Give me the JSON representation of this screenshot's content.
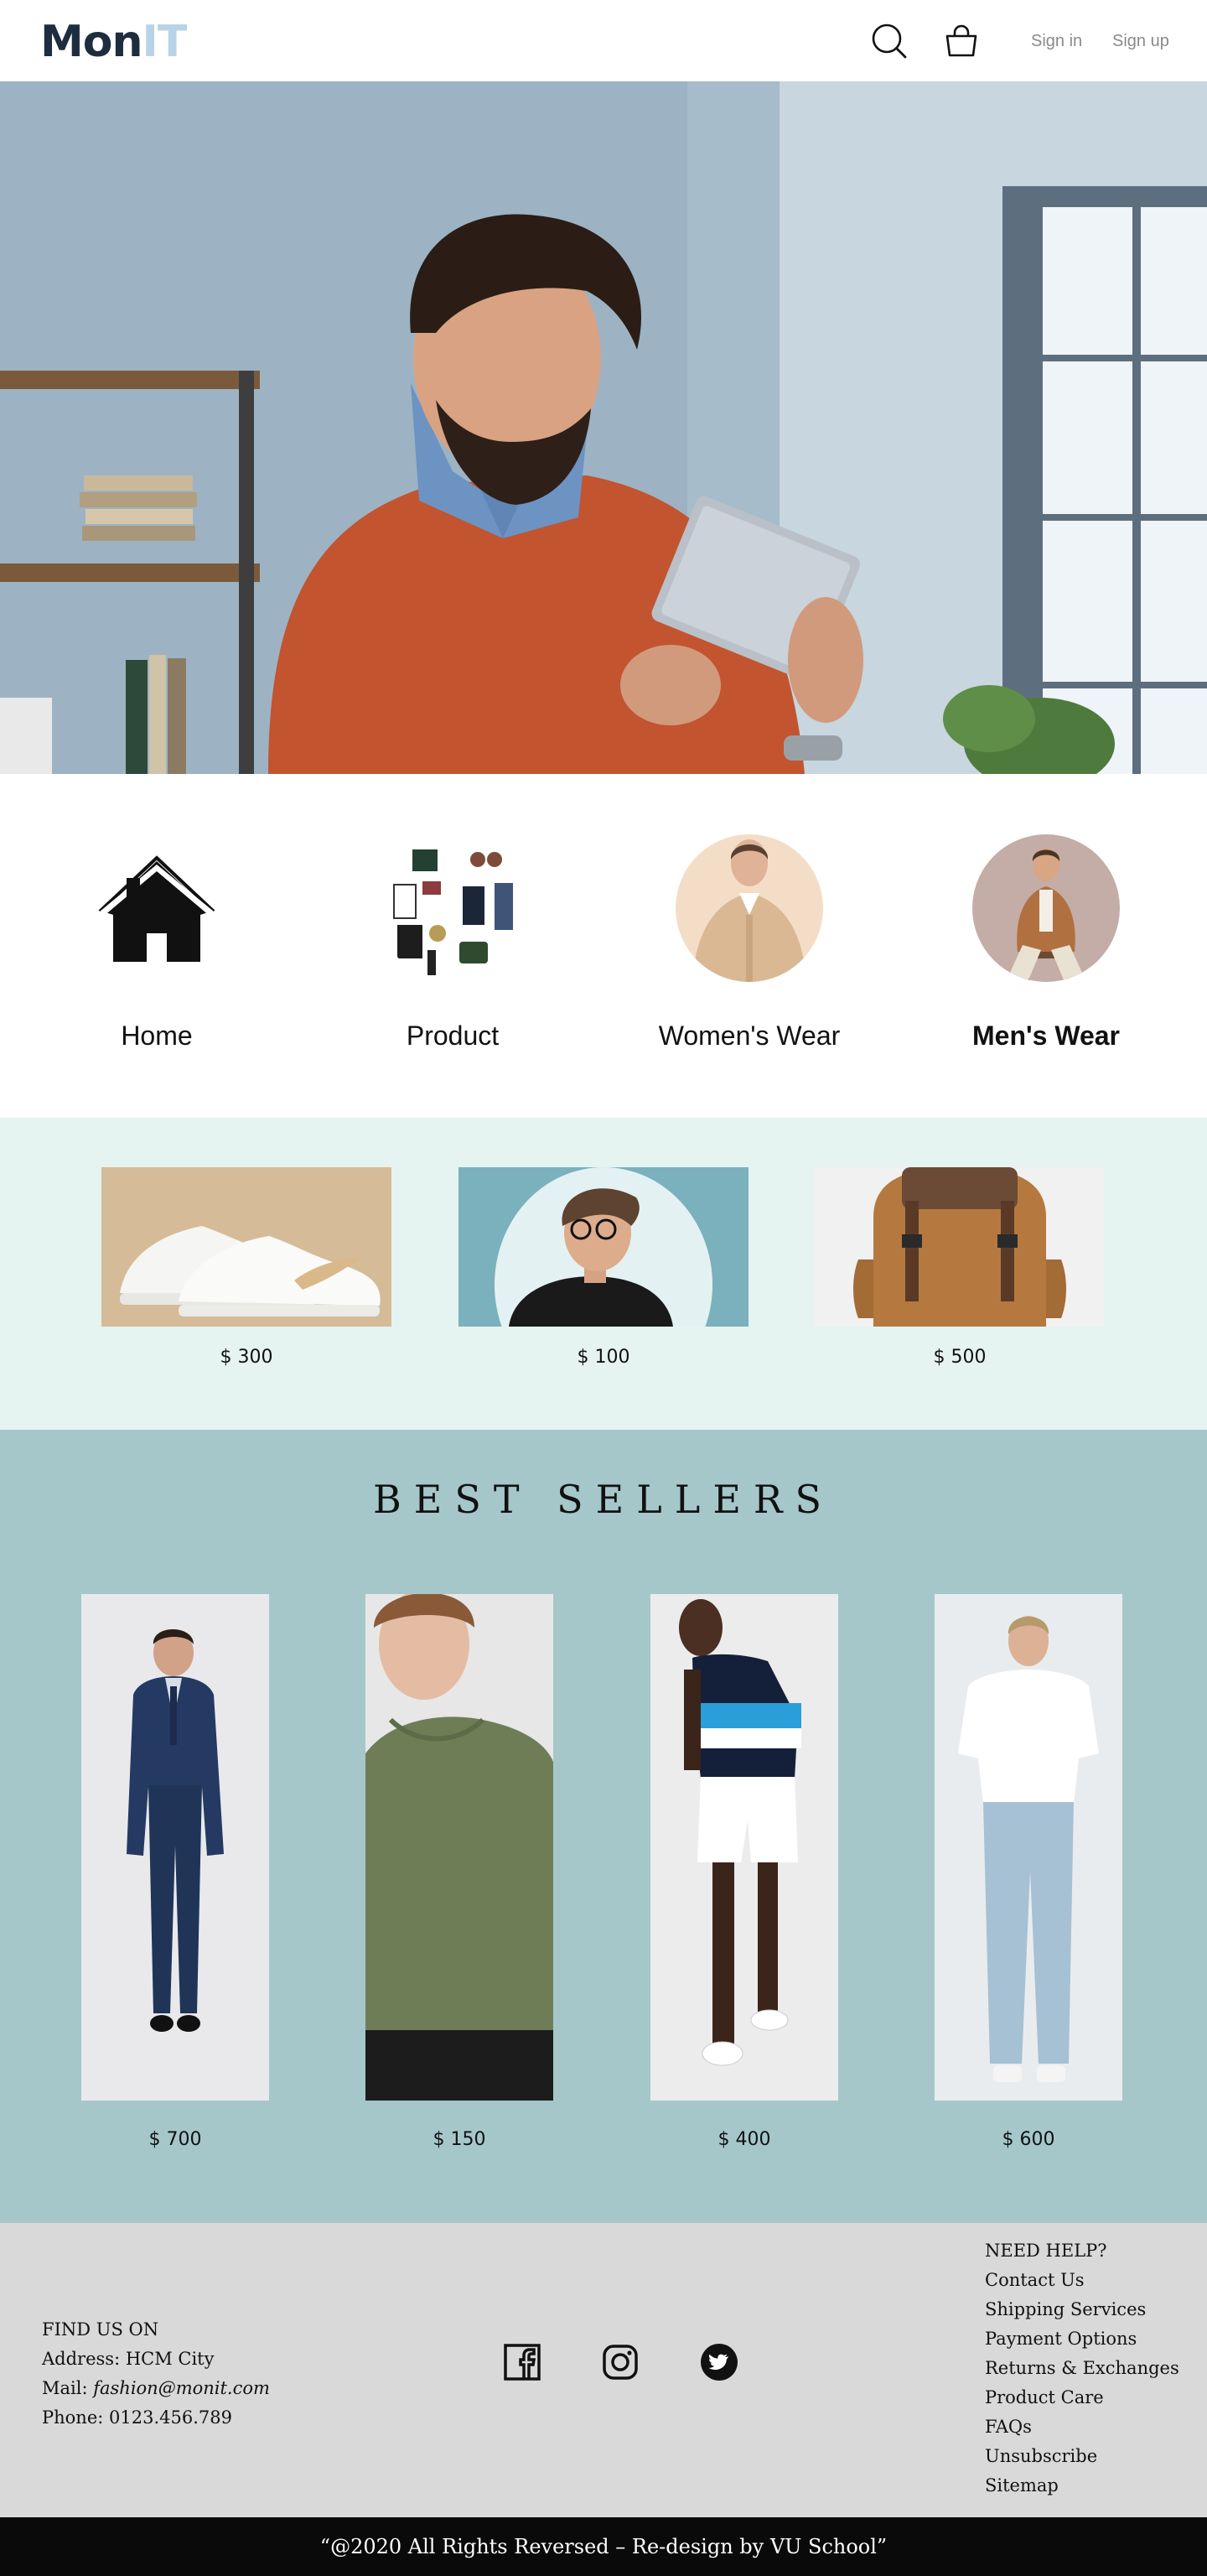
{
  "header": {
    "logo_part1": "Mon",
    "logo_part2": "IT",
    "search_icon": "search-icon",
    "cart_icon": "shopping-bag-icon",
    "sign_in": "Sign in",
    "sign_up": "Sign up"
  },
  "hero": {
    "image": "man-in-orange-sweater-with-tablet-photo"
  },
  "categories": [
    {
      "label": "Home",
      "icon": "house-icon"
    },
    {
      "label": "Product",
      "image": "accessories-collage-photo"
    },
    {
      "label": "Women's Wear",
      "image": "woman-in-beige-shirt-photo"
    },
    {
      "label": "Men's Wear",
      "image": "man-in-brown-jacket-photo"
    }
  ],
  "featured": [
    {
      "price": "$ 300",
      "image": "white-sneakers-photo"
    },
    {
      "price": "$ 100",
      "image": "man-with-glasses-photo"
    },
    {
      "price": "$ 500",
      "image": "brown-backpack-photo"
    }
  ],
  "best_sellers": {
    "title": "BEST SELLERS",
    "items": [
      {
        "price": "$ 700",
        "image": "navy-suit-photo"
      },
      {
        "price": "$ 150",
        "image": "olive-tshirt-photo"
      },
      {
        "price": "$ 400",
        "image": "polo-and-shorts-photo"
      },
      {
        "price": "$ 600",
        "image": "white-tee-and-jeans-photo"
      }
    ]
  },
  "footer": {
    "contact": {
      "heading": "FIND US ON",
      "address": "Address: HCM City",
      "mail_label": "Mail: ",
      "mail": "fashion@monit.com",
      "phone": "Phone: 0123.456.789"
    },
    "social": [
      "facebook-icon",
      "instagram-icon",
      "twitter-icon"
    ],
    "help": {
      "heading": "NEED HELP?",
      "links": [
        "Contact Us",
        "Shipping Services",
        "Payment Options",
        "Returns & Exchanges",
        "Product Care",
        "FAQs",
        "Unsubscribe",
        "Sitemap"
      ]
    },
    "copyright": "“@2020 All Rights Reversed – Re-design by VU School”"
  },
  "colors": {
    "featured_bg": "#e5f3f1",
    "best_sellers_bg": "#a5c7ca",
    "footer_bg": "#d9d9d9",
    "copyright_bg": "#0a0a0a",
    "logo_dark": "#1d2d3f",
    "logo_light": "#b9d3e6"
  }
}
